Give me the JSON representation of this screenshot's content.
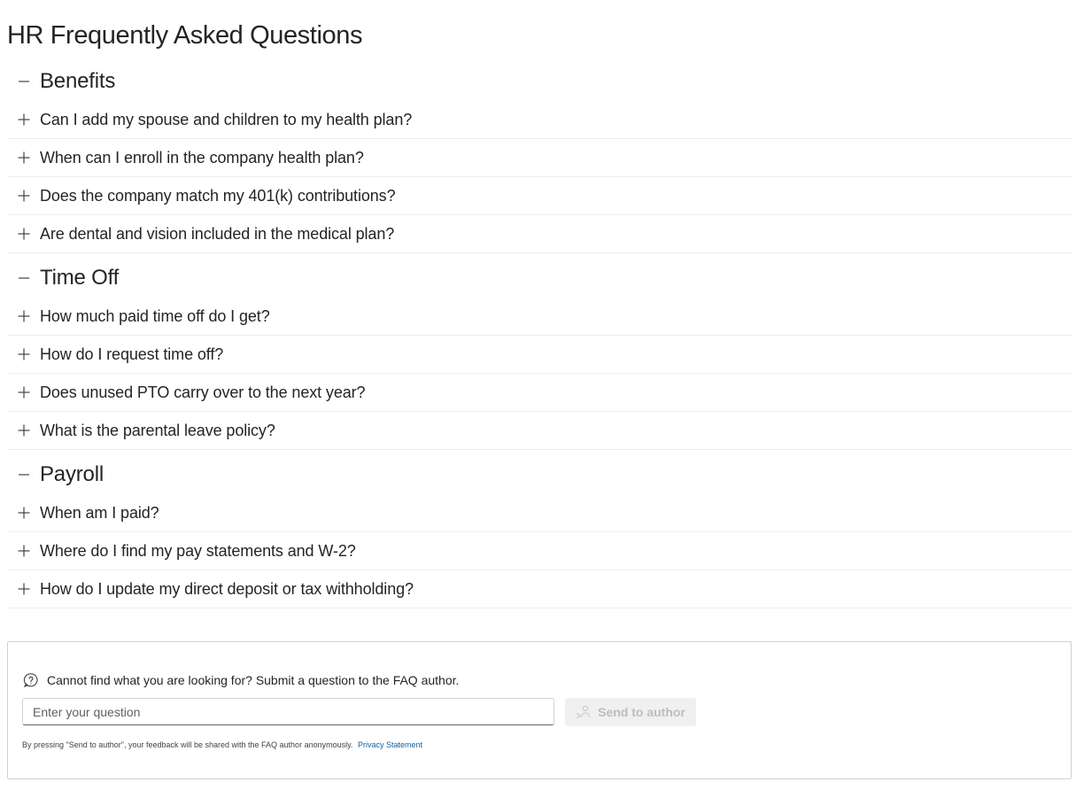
{
  "page": {
    "title": "HR Frequently Asked Questions"
  },
  "sections": [
    {
      "title": "Benefits",
      "expanded": true,
      "questions": [
        "Can I add my spouse and children to my health plan?",
        "When can I enroll in the company health plan?",
        "Does the company match my 401(k) contributions?",
        "Are dental and vision included in the medical plan?"
      ]
    },
    {
      "title": "Time Off",
      "expanded": true,
      "questions": [
        "How much paid time off do I get?",
        "How do I request time off?",
        "Does unused PTO carry over to the next year?",
        "What is the parental leave policy?"
      ]
    },
    {
      "title": "Payroll",
      "expanded": true,
      "questions": [
        "When am I paid?",
        "Where do I find my pay statements and W-2?",
        "How do I update my direct deposit or tax withholding?"
      ]
    }
  ],
  "icons": {
    "section_toggle": "minus-icon",
    "question_toggle": "plus-icon",
    "ask": "question-bubble-icon",
    "send": "people-send-icon"
  },
  "ask": {
    "prompt": "Cannot find what you are looking for? Submit a question to the FAQ author.",
    "input_placeholder": "Enter your question",
    "input_value": "",
    "send_label": "Send to author",
    "send_enabled": false,
    "disclaimer": "By pressing \"Send to author\", your feedback will be shared with the FAQ author anonymously.",
    "privacy_link": "Privacy Statement"
  },
  "colors": {
    "text": "#242424",
    "divider": "#ededed",
    "link": "#115ea3",
    "button_disabled_bg": "#f0f0f0",
    "button_disabled_text": "#bdbdbd"
  }
}
